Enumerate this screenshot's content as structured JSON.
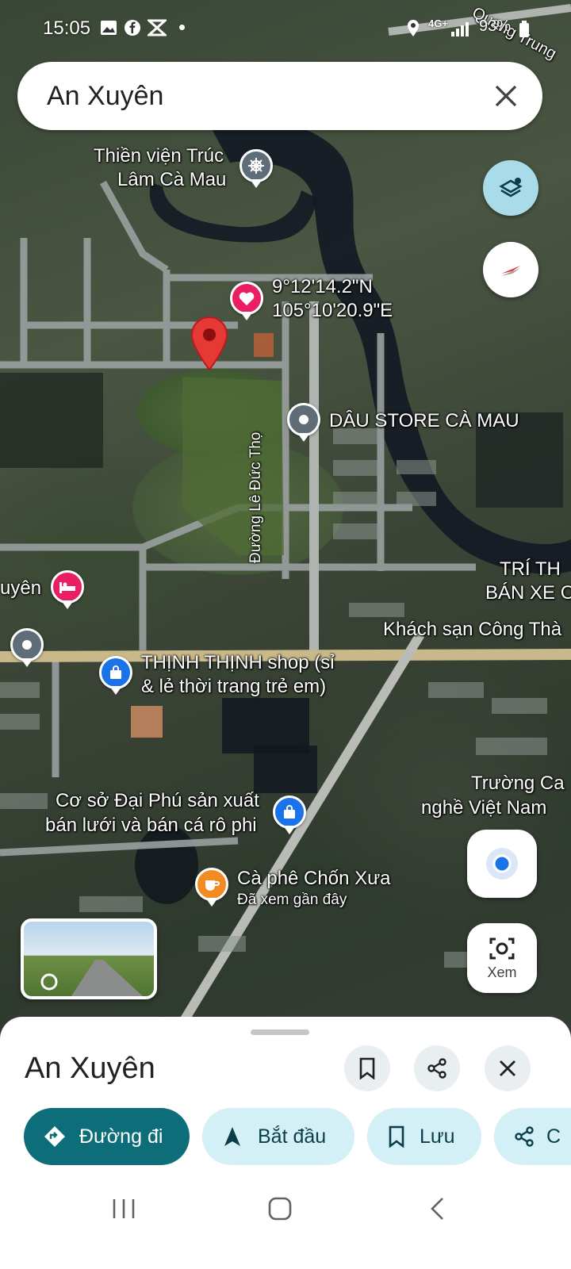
{
  "status_bar": {
    "time": "15:05",
    "network": "4G+",
    "battery": "93%"
  },
  "search": {
    "query": "An Xuyên"
  },
  "map": {
    "coordinates": {
      "lat": "9°12'14.2\"N",
      "lng": "105°10'20.9\"E"
    },
    "labels": {
      "quang_trung": "Quang Trung",
      "thien_vien_1": "Thiền viện Trúc",
      "thien_vien_2": "Lâm Cà Mau",
      "dau_store": "DÂU STORE CÀ MAU",
      "duong_le_duc_tho": "Đường Lê Đức Thọ",
      "tri_th": "TRÍ TH",
      "ban_xe_ot": "BÁN XE OT",
      "khach_san": "Khách sạn Công Thà",
      "an_xuyen_partial": "uyên",
      "thinh_shop_1": "THỊNH THỊNH shop (sỉ",
      "thinh_shop_2": "& lẻ thời trang trẻ em)",
      "truong_ca": "Trường Ca",
      "nghe_viet_nam": "nghề Việt Nam",
      "dai_phu_1": "Cơ sở Đại Phú sản xuất",
      "dai_phu_2": "bán lưới và bán cá rô phi",
      "ca_phe": "Cà phê Chốn Xưa",
      "recently_viewed": "Đã xem gần đây"
    }
  },
  "controls": {
    "lens_label": "Xem"
  },
  "bottom_sheet": {
    "title": "An Xuyên",
    "chips": {
      "directions": "Đường đi",
      "start": "Bắt đầu",
      "save": "Lưu",
      "share_partial": "C"
    }
  },
  "colors": {
    "accent_teal": "#0d6e7a",
    "chip_bg": "#d3f0f6",
    "pin_red": "#e53935",
    "pin_blue": "#1a73e8",
    "pin_pink": "#e91e63",
    "pin_orange": "#f28b22",
    "pin_gray": "#5f6d78"
  }
}
